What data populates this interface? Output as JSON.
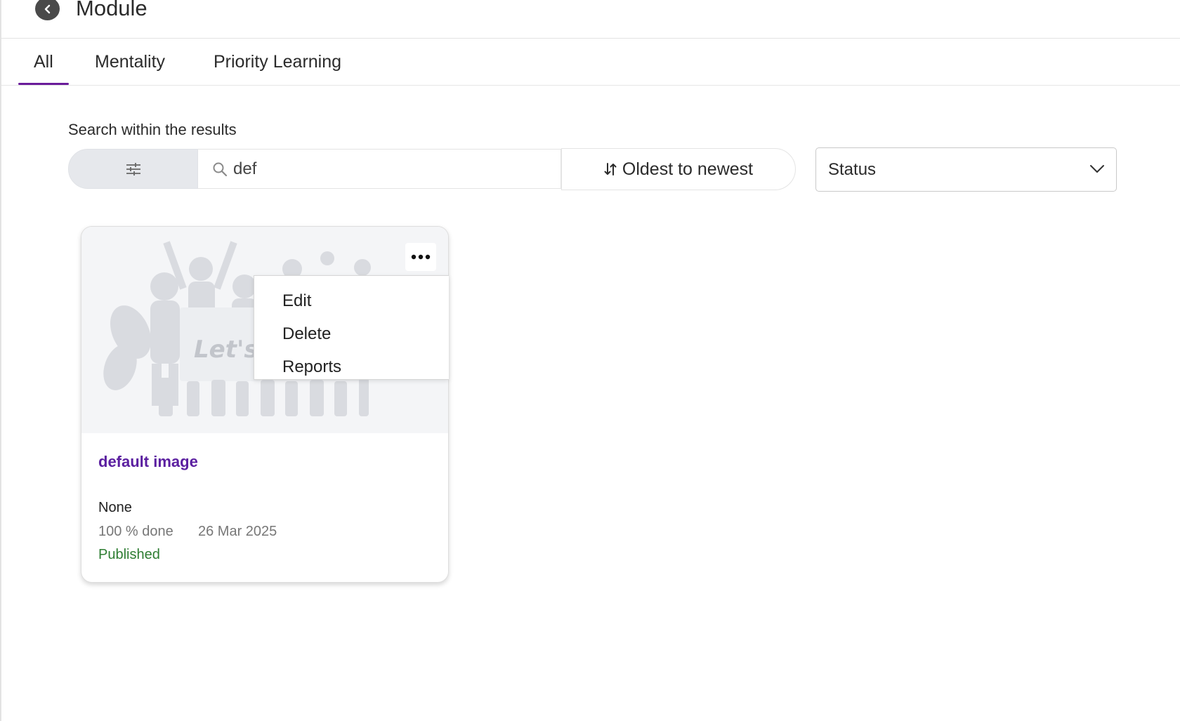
{
  "header": {
    "title": "Module"
  },
  "tabs": [
    {
      "label": "All",
      "active": true
    },
    {
      "label": "Mentality",
      "active": false
    },
    {
      "label": "Priority Learning",
      "active": false
    }
  ],
  "search": {
    "label": "Search within the results",
    "value": "def",
    "sort_label": "Oldest to newest",
    "status_label": "Status"
  },
  "card": {
    "image_text": "Let's c",
    "title": "default image",
    "category": "None",
    "progress": "100 % done",
    "date": "26 Mar 2025",
    "status": "Published"
  },
  "menu": {
    "items": [
      "Edit",
      "Delete",
      "Reports"
    ]
  },
  "colors": {
    "accent": "#6a1b9a",
    "title": "#5b1fa0",
    "published": "#2e7d32"
  }
}
